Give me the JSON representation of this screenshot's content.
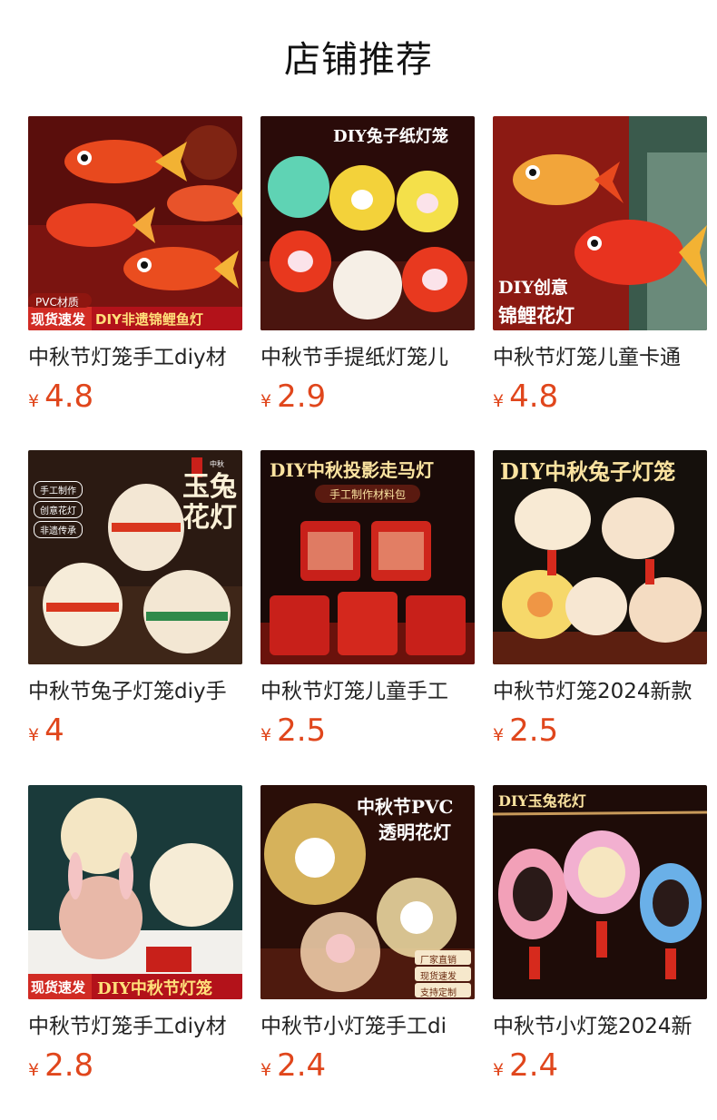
{
  "page": {
    "title": "店铺推荐"
  },
  "currency_symbol": "¥",
  "products": [
    {
      "name": "中秋节灯笼手工diy材",
      "price": "4.8",
      "overlay": {
        "badge": "PVC材质",
        "tag": "现货速发",
        "banner": "DIY非遗锦鲤鱼灯"
      }
    },
    {
      "name": "中秋节手提纸灯笼儿",
      "price": "2.9",
      "overlay": {
        "headline": "DIY兔子纸灯笼"
      }
    },
    {
      "name": "中秋节灯笼儿童卡通",
      "price": "4.8",
      "overlay": {
        "line1": "DIY创意",
        "line2": "锦鲤花灯"
      }
    },
    {
      "name": "中秋节兔子灯笼diy手",
      "price": "4",
      "overlay": {
        "headline": "玉兔花灯",
        "seal": "中秋",
        "pill1": "手工制作",
        "pill2": "创意花灯",
        "pill3": "非遗传承"
      }
    },
    {
      "name": "中秋节灯笼儿童手工",
      "price": "2.5",
      "overlay": {
        "headline": "DIY中秋投影走马灯",
        "sub": "手工制作材料包"
      }
    },
    {
      "name": "中秋节灯笼2024新款",
      "price": "2.5",
      "overlay": {
        "headline": "DIY中秋兔子灯笼"
      }
    },
    {
      "name": "中秋节灯笼手工diy材",
      "price": "2.8",
      "overlay": {
        "tag": "现货速发",
        "banner": "DIY中秋节灯笼"
      }
    },
    {
      "name": "中秋节小灯笼手工di",
      "price": "2.4",
      "overlay": {
        "line1": "中秋节PVC",
        "line2": "透明花灯",
        "pill1": "厂家直销",
        "pill2": "现货速发",
        "pill3": "支持定制"
      }
    },
    {
      "name": "中秋节小灯笼2024新",
      "price": "2.4",
      "overlay": {
        "headline": "DIY玉兔花灯"
      }
    }
  ],
  "colors": {
    "price": "#e0461c",
    "title": "#111111",
    "name": "#222222"
  }
}
